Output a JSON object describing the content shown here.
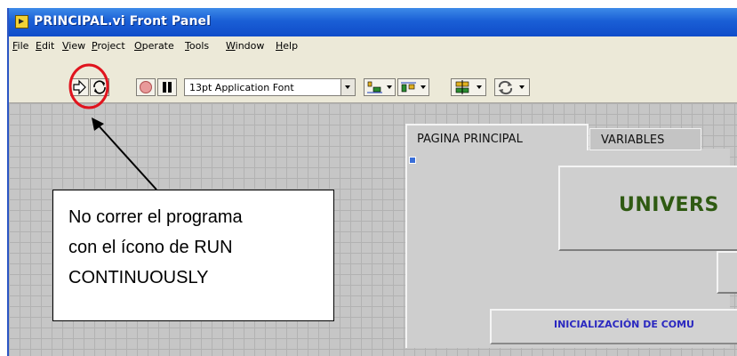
{
  "window": {
    "title": "PRINCIPAL.vi Front Panel"
  },
  "menu": [
    {
      "label": "File",
      "key": "F",
      "rest": "ile"
    },
    {
      "label": "Edit",
      "key": "E",
      "rest": "dit"
    },
    {
      "label": "View",
      "key": "V",
      "rest": "iew"
    },
    {
      "label": "Project",
      "key": "P",
      "rest": "roject"
    },
    {
      "label": "Operate",
      "key": "O",
      "rest": "perate"
    },
    {
      "label": "Tools",
      "key": "T",
      "rest": "ools"
    },
    {
      "label": "Window",
      "key": "W",
      "rest": "indow"
    },
    {
      "label": "Help",
      "key": "H",
      "rest": "elp"
    }
  ],
  "toolbar": {
    "font_select": "13pt Application Font",
    "buttons": [
      "run-icon",
      "run-continuously-icon",
      "abort-icon",
      "pause-icon",
      "align-icon",
      "distribute-icon",
      "resize-icon",
      "reorder-icon"
    ]
  },
  "tabs": {
    "active": "PAGINA PRINCIPAL",
    "inactive": "VARIABLES"
  },
  "panel": {
    "title_button": "UNIVERS",
    "init_button": "INICIALIZACIÓN DE COMU"
  },
  "annotation": {
    "line1": "No correr el programa",
    "line2": "con el ícono de RUN",
    "line3": "CONTINUOUSLY",
    "circle_color": "#e0141e",
    "arrow_color": "#000000"
  },
  "colors": {
    "titlebar": "#1a5fd6",
    "canvas": "#c6c6c6",
    "title_button_text": "#2f5a12",
    "init_button_text": "#2a28c0"
  }
}
